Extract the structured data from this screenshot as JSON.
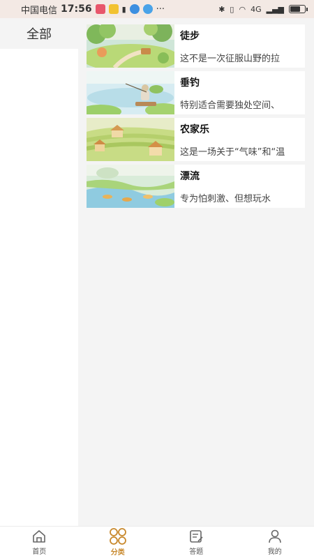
{
  "status_bar": {
    "carrier": "中国电信",
    "time": "17:56",
    "network": "4G",
    "more": "···"
  },
  "sidebar": {
    "items": [
      {
        "label": "全部"
      }
    ]
  },
  "list": {
    "items": [
      {
        "title": "徒步",
        "desc": "这不是一次征服山野的拉",
        "icon": "hiking-scene-image"
      },
      {
        "title": "垂钓",
        "desc": "特别适合需要独处空间、",
        "icon": "fishing-scene-image"
      },
      {
        "title": "农家乐",
        "desc": "这是一场关于“气味”和“温",
        "icon": "farm-scene-image"
      },
      {
        "title": "漂流",
        "desc": "专为怕刺激、但想玩水",
        "icon": "rafting-scene-image"
      }
    ]
  },
  "tabbar": {
    "tabs": [
      {
        "label": "首页",
        "icon": "home-icon"
      },
      {
        "label": "分类",
        "icon": "category-icon",
        "active": true
      },
      {
        "label": "答题",
        "icon": "quiz-icon"
      },
      {
        "label": "我的",
        "icon": "user-icon"
      }
    ]
  },
  "colors": {
    "accent": "#c8892d",
    "background": "#f4f4f4",
    "statusbar": "#f3e9e4"
  }
}
